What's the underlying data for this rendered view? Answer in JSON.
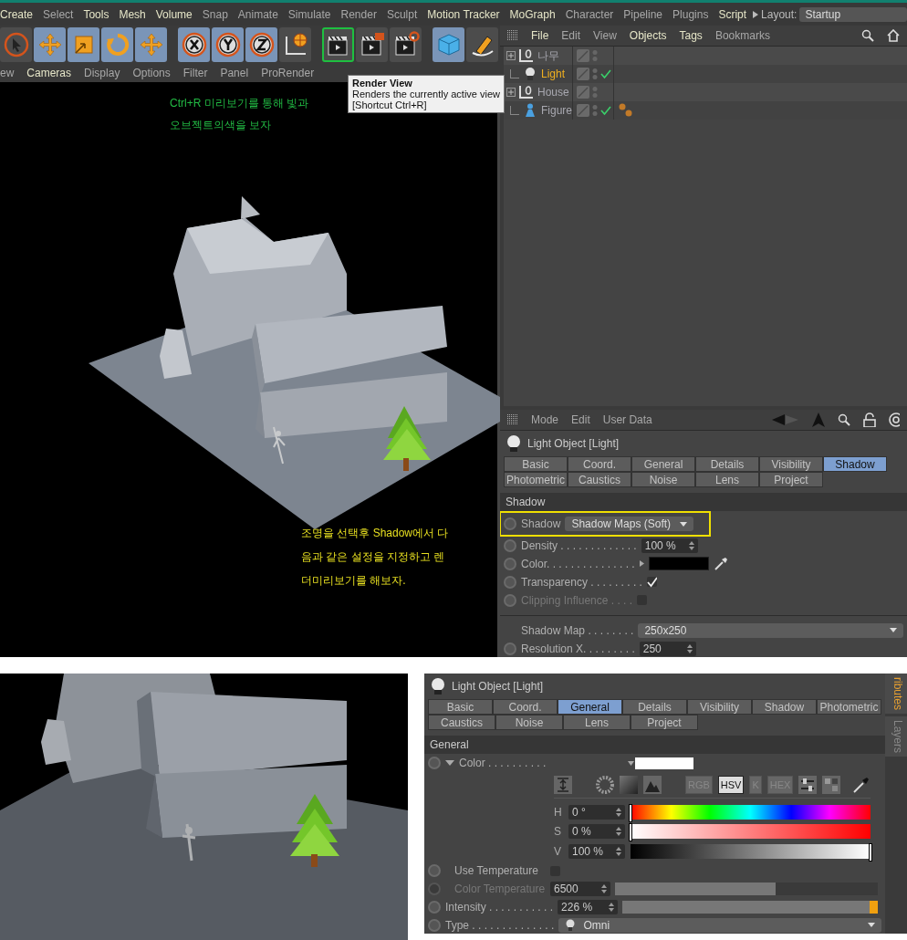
{
  "menu_bar": {
    "items": [
      {
        "label": "Create",
        "emphasized": true
      },
      {
        "label": "Select",
        "emphasized": false
      },
      {
        "label": "Tools",
        "emphasized": true
      },
      {
        "label": "Mesh",
        "emphasized": true
      },
      {
        "label": "Volume",
        "emphasized": true
      },
      {
        "label": "Snap",
        "emphasized": false
      },
      {
        "label": "Animate",
        "emphasized": false
      },
      {
        "label": "Simulate",
        "emphasized": false
      },
      {
        "label": "Render",
        "emphasized": false
      },
      {
        "label": "Sculpt",
        "emphasized": false
      },
      {
        "label": "Motion Tracker",
        "emphasized": true
      },
      {
        "label": "MoGraph",
        "emphasized": true
      },
      {
        "label": "Character",
        "emphasized": false
      },
      {
        "label": "Pipeline",
        "emphasized": false
      },
      {
        "label": "Plugins",
        "emphasized": false
      },
      {
        "label": "Script",
        "emphasized": true
      }
    ],
    "layout_label": "Layout:",
    "layout_value": "Startup"
  },
  "toolbar": [
    {
      "kind": "select",
      "selected": false,
      "annotated": false
    },
    {
      "kind": "move",
      "selected": true,
      "annotated": false
    },
    {
      "kind": "scale",
      "selected": true,
      "annotated": false
    },
    {
      "kind": "rotate",
      "selected": true,
      "annotated": false
    },
    {
      "kind": "transform",
      "selected": true,
      "annotated": false
    },
    {
      "kind": "x",
      "selected": true,
      "annotated": false
    },
    {
      "kind": "y",
      "selected": true,
      "annotated": false
    },
    {
      "kind": "z",
      "selected": true,
      "annotated": false
    },
    {
      "kind": "world",
      "selected": false,
      "annotated": false
    },
    {
      "kind": "render-view",
      "selected": false,
      "annotated": true
    },
    {
      "kind": "render-picture",
      "selected": false,
      "annotated": false
    },
    {
      "kind": "render-settings",
      "selected": false,
      "annotated": false
    },
    {
      "kind": "cube",
      "selected": true,
      "annotated": false
    },
    {
      "kind": "pen",
      "selected": false,
      "annotated": false
    }
  ],
  "tooltip": {
    "title": "Render View",
    "text": "Renders the currently active view",
    "shortcut": "[Shortcut Ctrl+R]"
  },
  "viewport": {
    "menu": [
      {
        "label": "ew",
        "emphasized": false
      },
      {
        "label": "Cameras",
        "emphasized": true
      },
      {
        "label": "Display",
        "emphasized": false
      },
      {
        "label": "Options",
        "emphasized": false
      },
      {
        "label": "Filter",
        "emphasized": false
      },
      {
        "label": "Panel",
        "emphasized": false
      },
      {
        "label": "ProRender",
        "emphasized": false
      }
    ],
    "notes": [
      {
        "color": "#22bb44",
        "lines": [
          "Ctrl+R 미리보기를 통해 빛과",
          "오브젝트의색을 보자"
        ]
      },
      {
        "color": "#e8e020",
        "lines": [
          "조명을 선택후 Shadow에서 다",
          "음과 같은 설정을 지정하고 렌",
          "더미리보기를 해보자."
        ]
      }
    ]
  },
  "object_manager": {
    "menu": [
      {
        "label": "File",
        "emphasized": true
      },
      {
        "label": "Edit",
        "emphasized": false
      },
      {
        "label": "View",
        "emphasized": false
      },
      {
        "label": "Objects",
        "emphasized": true
      },
      {
        "label": "Tags",
        "emphasized": true
      },
      {
        "label": "Bookmarks",
        "emphasized": false
      }
    ],
    "objects": [
      {
        "name": "나무",
        "kind": "null",
        "expandable": true,
        "selected": false,
        "checked": false,
        "has_tags": false
      },
      {
        "name": "Light",
        "kind": "light",
        "expandable": false,
        "selected": true,
        "checked": true,
        "has_tags": false
      },
      {
        "name": "House",
        "kind": "null",
        "expandable": true,
        "selected": false,
        "checked": false,
        "has_tags": false
      },
      {
        "name": "Figure",
        "kind": "figure",
        "expandable": false,
        "selected": false,
        "checked": true,
        "has_tags": true
      }
    ]
  },
  "attributes": {
    "menu": [
      "Mode",
      "Edit",
      "User Data"
    ],
    "title": "Light Object [Light]",
    "tabs": [
      [
        {
          "label": "Basic",
          "selected": false
        },
        {
          "label": "Coord.",
          "selected": false
        },
        {
          "label": "General",
          "selected": false
        },
        {
          "label": "Details",
          "selected": false
        },
        {
          "label": "Visibility",
          "selected": false
        },
        {
          "label": "Shadow",
          "selected": true
        }
      ],
      [
        {
          "label": "Photometric",
          "selected": false
        },
        {
          "label": "Caustics",
          "selected": false
        },
        {
          "label": "Noise",
          "selected": false
        },
        {
          "label": "Lens",
          "selected": false
        },
        {
          "label": "Project",
          "selected": false
        }
      ]
    ],
    "section": "Shadow",
    "params": [
      {
        "kind": "dropdown",
        "label": "Shadow",
        "value": "Shadow Maps (Soft)",
        "animatable": true,
        "disabled": false,
        "annotated": true
      },
      {
        "kind": "number",
        "label": "Density . . . . . . . . . . . . .",
        "value": "100 %",
        "animatable": true,
        "disabled": false,
        "annotated": false
      },
      {
        "kind": "color",
        "label": "Color. . . . . . . . . . . . . . .",
        "color": "#000000",
        "animatable": true,
        "disabled": false,
        "annotated": false
      },
      {
        "kind": "checkbox",
        "label": "Transparency . . . . . . . . .",
        "checked": true,
        "animatable": true,
        "disabled": false,
        "annotated": false
      },
      {
        "kind": "checkbox",
        "label": "Clipping Influence . . . .",
        "checked": false,
        "animatable": true,
        "disabled": true,
        "annotated": false
      },
      {
        "kind": "divider"
      },
      {
        "kind": "wide-dropdown",
        "label": "Shadow Map . . . . . . . .",
        "value": "250x250",
        "animatable": false,
        "disabled": false,
        "annotated": false
      },
      {
        "kind": "number",
        "label": "Resolution X. . . . . . . . .",
        "value": "250",
        "animatable": true,
        "disabled": false,
        "annotated": false
      }
    ]
  },
  "second_attributes": {
    "title": "Light Object [Light]",
    "tabs": [
      [
        {
          "label": "Basic",
          "selected": false
        },
        {
          "label": "Coord.",
          "selected": false
        },
        {
          "label": "General",
          "selected": true
        },
        {
          "label": "Details",
          "selected": false
        },
        {
          "label": "Visibility",
          "selected": false
        },
        {
          "label": "Shadow",
          "selected": false
        },
        {
          "label": "Photometric",
          "selected": false
        }
      ],
      [
        {
          "label": "Caustics",
          "selected": false
        },
        {
          "label": "Noise",
          "selected": false
        },
        {
          "label": "Lens",
          "selected": false
        },
        {
          "label": "Project",
          "selected": false
        }
      ]
    ],
    "section": "General",
    "side_tabs": [
      {
        "label": "ributes",
        "selected": true
      },
      {
        "label": "Layers",
        "selected": false
      }
    ],
    "color_param": {
      "label": "Color . . . . . . . . . .",
      "color": "#ffffff",
      "disabled": false,
      "modes": [
        {
          "label": "RGB",
          "selected": false
        },
        {
          "label": "HSV",
          "selected": true
        },
        {
          "label": "K",
          "selected": false
        },
        {
          "label": "HEX",
          "selected": false
        }
      ],
      "channels": [
        {
          "label": "H",
          "kind": "hue",
          "value": "0 °",
          "level": 0
        },
        {
          "label": "S",
          "kind": "saturation",
          "value": "0 %",
          "level": 0
        },
        {
          "label": "V",
          "kind": "value",
          "value": "100 %",
          "level": 1
        }
      ]
    },
    "params": [
      {
        "kind": "checkbox",
        "label": "Use Temperature",
        "checked": false,
        "disabled": false
      },
      {
        "kind": "slider",
        "label": "Color Temperature",
        "value": "6500",
        "level": 0.63,
        "disabled": true
      },
      {
        "kind": "slider",
        "label": "Intensity . . . . . . . . . . .",
        "value": "226 %",
        "level": 1,
        "disabled": false
      },
      {
        "kind": "dropdown",
        "label": "Type . . . . . . . . . . . . . .",
        "value": "Omni",
        "disabled": false
      }
    ]
  }
}
